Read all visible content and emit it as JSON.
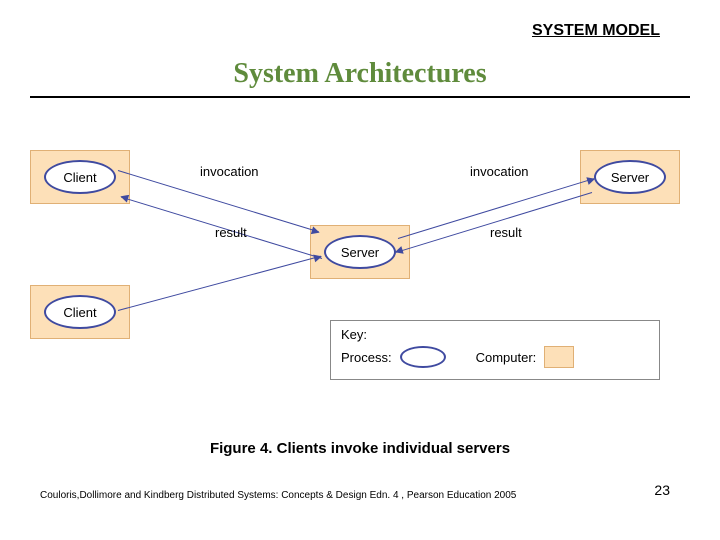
{
  "header": {
    "label": "SYSTEM MODEL"
  },
  "title": "System Architectures",
  "diagram": {
    "nodes": {
      "client1": "Client",
      "client2": "Client",
      "server_center": "Server",
      "server_right": "Server"
    },
    "labels": {
      "invocation1": "invocation",
      "invocation2": "invocation",
      "result1": "result",
      "result2": "result"
    },
    "key": {
      "title": "Key:",
      "process": "Process:",
      "computer": "Computer:"
    }
  },
  "caption": "Figure 4. Clients invoke individual servers",
  "citation": "Couloris,Dollimore and Kindberg  Distributed Systems: Concepts & Design  Edn. 4 , Pearson Education 2005",
  "page": "23"
}
